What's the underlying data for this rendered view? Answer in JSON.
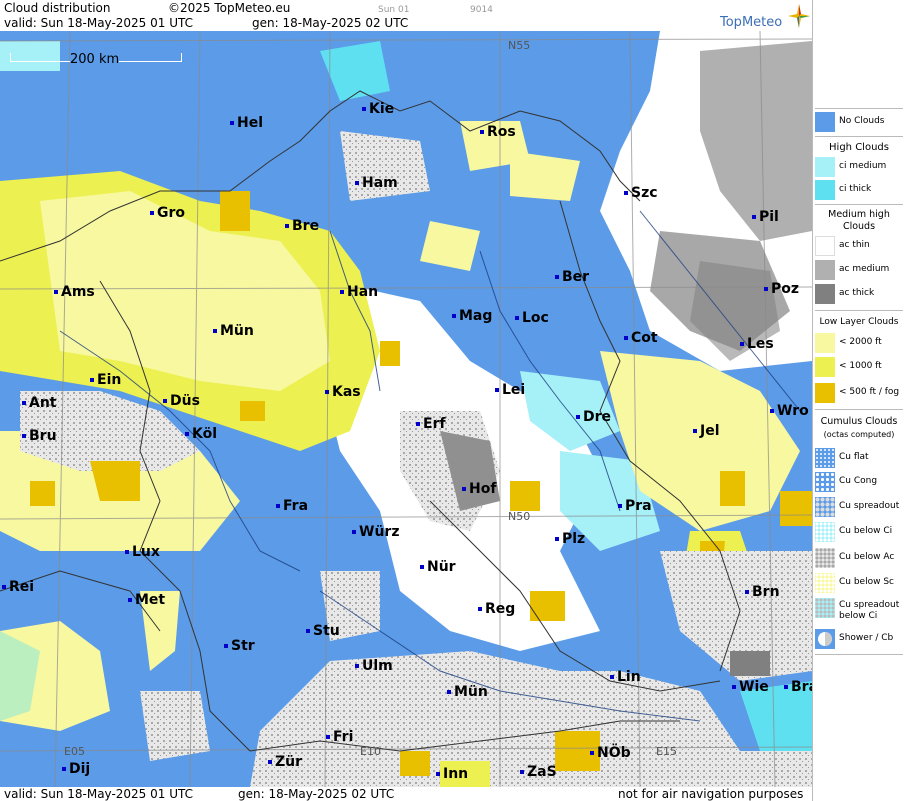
{
  "header": {
    "title": "Cloud distribution",
    "copyright": "©2025 TopMeteo.eu",
    "run_label": "Sun 01",
    "code": "9014",
    "valid": "valid:  Sun  18-May-2025  01 UTC",
    "gen": "gen: 18-May-2025 02 UTC",
    "logo": "TopMeteo"
  },
  "footer": {
    "valid": "valid:  Sun  18-May-2025  01 UTC",
    "gen": "gen: 18-May-2025 02 UTC",
    "disclaimer": "not for air navigation purposes"
  },
  "scale": "200 km",
  "grid_labels": [
    "N55",
    "N50",
    "E05",
    "E10",
    "E15"
  ],
  "cities": [
    {
      "name": "Hel"
    },
    {
      "name": "Kie"
    },
    {
      "name": "Ros"
    },
    {
      "name": "Ham"
    },
    {
      "name": "Szc"
    },
    {
      "name": "Gro"
    },
    {
      "name": "Bre"
    },
    {
      "name": "Pil"
    },
    {
      "name": "Ber"
    },
    {
      "name": "Ams"
    },
    {
      "name": "Han"
    },
    {
      "name": "Poz"
    },
    {
      "name": "Mag"
    },
    {
      "name": "Loc"
    },
    {
      "name": "Mün"
    },
    {
      "name": "Cot"
    },
    {
      "name": "Les"
    },
    {
      "name": "Ein"
    },
    {
      "name": "Kas"
    },
    {
      "name": "Lei"
    },
    {
      "name": "Ant"
    },
    {
      "name": "Düs"
    },
    {
      "name": "Wro"
    },
    {
      "name": "Erf"
    },
    {
      "name": "Dre"
    },
    {
      "name": "Bru"
    },
    {
      "name": "Köl"
    },
    {
      "name": "Jel"
    },
    {
      "name": "Hof"
    },
    {
      "name": "Fra"
    },
    {
      "name": "Pra"
    },
    {
      "name": "Würz"
    },
    {
      "name": "Plz"
    },
    {
      "name": "Lux"
    },
    {
      "name": "Nür"
    },
    {
      "name": "Rei"
    },
    {
      "name": "Brn"
    },
    {
      "name": "Met"
    },
    {
      "name": "Reg"
    },
    {
      "name": "Stu"
    },
    {
      "name": "Str"
    },
    {
      "name": "Ulm"
    },
    {
      "name": "Lin"
    },
    {
      "name": "Wie"
    },
    {
      "name": "Bra"
    },
    {
      "name": "Mün"
    },
    {
      "name": "Fri"
    },
    {
      "name": "Dij"
    },
    {
      "name": "Zür"
    },
    {
      "name": "Inn"
    },
    {
      "name": "ZaS"
    },
    {
      "name": "NÖb"
    }
  ],
  "legend": {
    "no_clouds": "No Clouds",
    "high_clouds": "High Clouds",
    "ci_medium": "ci medium",
    "ci_thick": "ci thick",
    "medium_high": "Medium high Clouds",
    "ac_thin": "ac thin",
    "ac_medium": "ac medium",
    "ac_thick": "ac thick",
    "low_layer": "Low Layer Clouds",
    "lt2000": "< 2000 ft",
    "lt1000": "< 1000 ft",
    "lt500": "< 500 ft / fog",
    "cumulus": "Cumulus Clouds",
    "octas": "(octas computed)",
    "cu_flat": "Cu flat",
    "cu_cong": "Cu Cong",
    "cu_spreadout": "Cu spreadout",
    "cu_below_ci": "Cu below Ci",
    "cu_below_ac": "Cu below Ac",
    "cu_below_sc": "Cu below Sc",
    "cu_spreadout_below_ci": "Cu spreadout below Ci",
    "shower": "Shower / Cb"
  },
  "colors": {
    "no_clouds": "#5b9be8",
    "ci_medium": "#a6f0f8",
    "ci_thick": "#5fe0f0",
    "ac_thin": "#ffffff",
    "ac_medium": "#b0b0b0",
    "ac_thick": "#808080",
    "low_2000": "#f8f8a0",
    "low_1000": "#ecf050",
    "low_500": "#e8c000"
  }
}
